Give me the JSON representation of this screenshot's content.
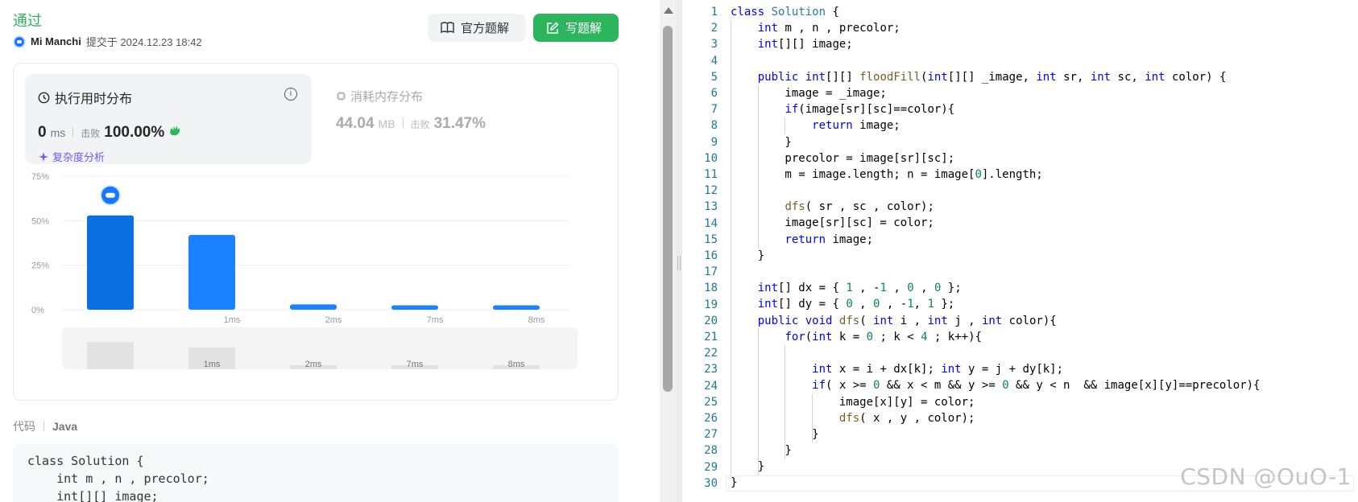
{
  "result": {
    "status": "通过",
    "submitter": "Mi Manchi",
    "submitted_text": "提交于 2024.12.23 18:42"
  },
  "buttons": {
    "official_solution": "官方题解",
    "write_solution": "写题解"
  },
  "runtime": {
    "title": "执行用时分布",
    "value": "0",
    "unit": "ms",
    "beat_label": "击败",
    "beat_value": "100.00%",
    "complexity_link": "复杂度分析"
  },
  "memory": {
    "title": "消耗内存分布",
    "value": "44.04",
    "unit": "MB",
    "beat_label": "击败",
    "beat_value": "31.47%"
  },
  "chart_data": {
    "type": "bar",
    "categories": [
      "",
      "1ms",
      "2ms",
      "7ms",
      "8ms"
    ],
    "values": [
      53,
      42,
      3,
      2.5,
      2.5
    ],
    "yticks": [
      "75%",
      "50%",
      "25%",
      "0%"
    ],
    "ylim": [
      0,
      75
    ],
    "highlight_index": 0,
    "colors": {
      "highlight": "#0a6fe0",
      "normal": "#1a82ff",
      "grid": "#eeeeee",
      "overview": "#e2e2e2"
    }
  },
  "code_section": {
    "label": "代码",
    "language": "Java",
    "preview_lines": [
      "class Solution {",
      "    int m , n , precolor;",
      "    int[][] image;"
    ]
  },
  "editor": {
    "lines": [
      "class Solution {",
      "    int m , n , precolor;",
      "    int[][] image;",
      "",
      "    public int[][] floodFill(int[][] _image, int sr, int sc, int color) {",
      "        image = _image;",
      "        if(image[sr][sc]==color){",
      "            return image;",
      "        }",
      "        precolor = image[sr][sc];",
      "        m = image.length; n = image[0].length;",
      "",
      "        dfs( sr , sc , color);",
      "        image[sr][sc] = color;",
      "        return image;",
      "    }",
      "",
      "    int[] dx = { 1 , -1 , 0 , 0 };",
      "    int[] dy = { 0 , 0 , -1, 1 };",
      "    public void dfs( int i , int j , int color){",
      "        for(int k = 0 ; k < 4 ; k++){",
      "",
      "            int x = i + dx[k]; int y = j + dy[k];",
      "            if( x >= 0 && x < m && y >= 0 && y < n  && image[x][y]==precolor){",
      "                image[x][y] = color;",
      "                dfs( x , y , color);",
      "            }",
      "        }",
      "    }",
      "}"
    ]
  },
  "watermark": "CSDN @OuO-1"
}
